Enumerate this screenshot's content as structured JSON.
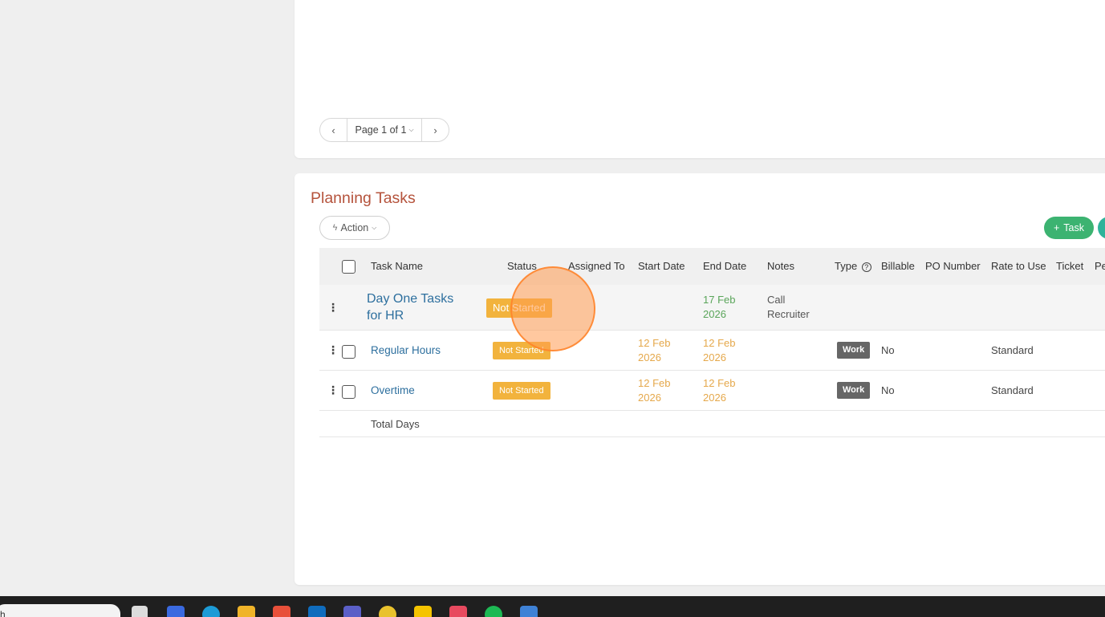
{
  "pagination": {
    "prev": "‹",
    "page_label": "Page 1 of 1",
    "next": "›"
  },
  "section": {
    "title": "Planning Tasks",
    "action_label": "Action",
    "add_task_label": "Task"
  },
  "table": {
    "headers": {
      "task_name": "Task Name",
      "status": "Status",
      "assigned_to": "Assigned To",
      "start_date": "Start Date",
      "end_date": "End Date",
      "notes": "Notes",
      "type": "Type",
      "billable": "Billable",
      "po_number": "PO Number",
      "rate": "Rate to Use",
      "ticket": "Ticket",
      "partial": "Pe"
    },
    "rows": [
      {
        "name": "Day One Tasks for HR",
        "status": "Not Started",
        "start_date": "",
        "end_date": "17 Feb 2026",
        "notes": "Call Recruiter",
        "type": "",
        "billable": "",
        "rate": ""
      },
      {
        "name": "Regular Hours",
        "status": "Not Started",
        "start_date": "12 Feb 2026",
        "end_date": "12 Feb 2026",
        "notes": "",
        "type": "Work",
        "billable": "No",
        "rate": "Standard"
      },
      {
        "name": "Overtime",
        "status": "Not Started",
        "start_date": "12 Feb 2026",
        "end_date": "12 Feb 2026",
        "notes": "",
        "type": "Work",
        "billable": "No",
        "rate": "Standard"
      }
    ],
    "footer_label": "Total Days"
  },
  "taskbar": {
    "search_text": "h"
  },
  "colors": {
    "title": "#b5533c",
    "link": "#2d6f9e",
    "status_badge": "#f2b33d",
    "add_button": "#3cb371"
  }
}
